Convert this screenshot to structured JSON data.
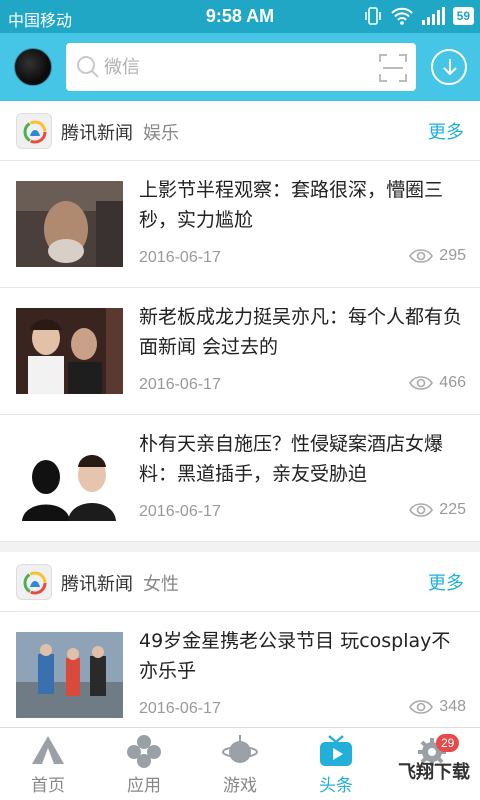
{
  "status_bar": {
    "carrier": "中国移动",
    "time": "9:58 AM",
    "battery": "59"
  },
  "top_bar": {
    "search_placeholder": "微信"
  },
  "sections": [
    {
      "source": "腾讯新闻",
      "category": "娱乐",
      "more": "更多",
      "items": [
        {
          "title": "上影节半程观察：套路很深，懵圈三秒，实力尴尬",
          "date": "2016-06-17",
          "views": "295"
        },
        {
          "title": "新老板成龙力挺吴亦凡：每个人都有负面新闻 会过去的",
          "date": "2016-06-17",
          "views": "466"
        },
        {
          "title": "朴有天亲自施压？性侵疑案酒店女爆料：黑道插手，亲友受胁迫",
          "date": "2016-06-17",
          "views": "225"
        }
      ]
    },
    {
      "source": "腾讯新闻",
      "category": "女性",
      "more": "更多",
      "items": [
        {
          "title": "49岁金星携老公录节目 玩cosplay不亦乐乎",
          "date": "2016-06-17",
          "views": "348"
        }
      ]
    }
  ],
  "bottom_nav": {
    "items": [
      {
        "label": "首页",
        "icon": "tent-icon"
      },
      {
        "label": "应用",
        "icon": "clover-icon"
      },
      {
        "label": "游戏",
        "icon": "planet-icon"
      },
      {
        "label": "头条",
        "icon": "tv-icon",
        "active": true
      },
      {
        "label": "",
        "icon": "gear-icon",
        "badge": "29"
      }
    ]
  },
  "watermark": "飞翔下载",
  "colors": {
    "header": "#45c6e6",
    "status": "#1fa7c5",
    "accent": "#1fb0d8",
    "badge": "#e84a4a"
  }
}
